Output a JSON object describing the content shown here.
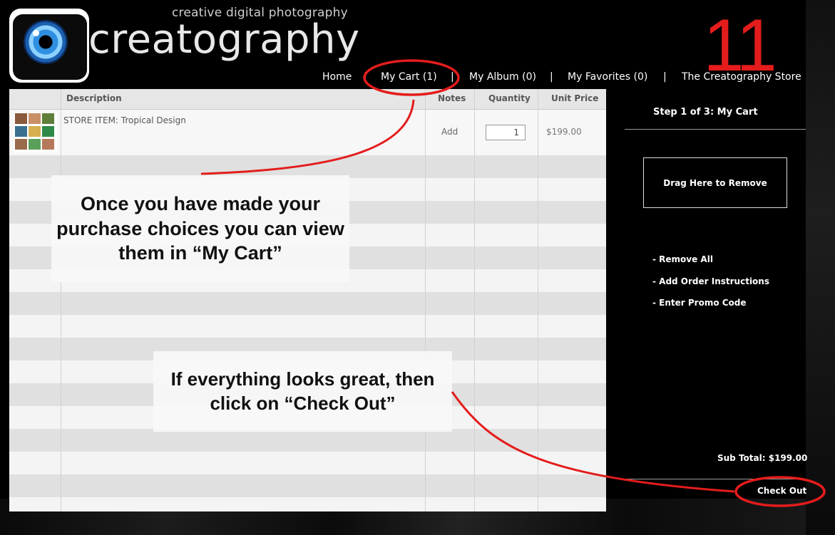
{
  "header": {
    "tagline": "creative digital photography",
    "brand": "creatography",
    "page_number": "11"
  },
  "nav": {
    "items": [
      "Home",
      "My Cart (1)",
      "My Album (0)",
      "My Favorites (0)",
      "The Creatography Store"
    ],
    "separator": "|"
  },
  "cart": {
    "columns": [
      "Description",
      "Notes",
      "Quantity",
      "Unit Price"
    ],
    "rows": [
      {
        "description": "STORE ITEM: Tropical Design",
        "notes": "Add",
        "quantity": "1",
        "unit_price": "$199.00"
      }
    ]
  },
  "sidebar": {
    "step_title": "Step 1 of 3: My Cart",
    "drop_zone": "Drag Here to Remove",
    "links": [
      "- Remove All",
      "- Add Order Instructions",
      "- Enter Promo Code"
    ],
    "subtotal": "Sub Total: $199.00",
    "checkout": "Check Out"
  },
  "callouts": {
    "cart_tip": "Once you have made your purchase choices you can view them in “My Cart”",
    "checkout_tip": "If everything looks great, then click on “Check Out”"
  },
  "colors": {
    "annotation_red": "#e41c1c",
    "background": "#000000",
    "table_bg": "#ececec"
  }
}
